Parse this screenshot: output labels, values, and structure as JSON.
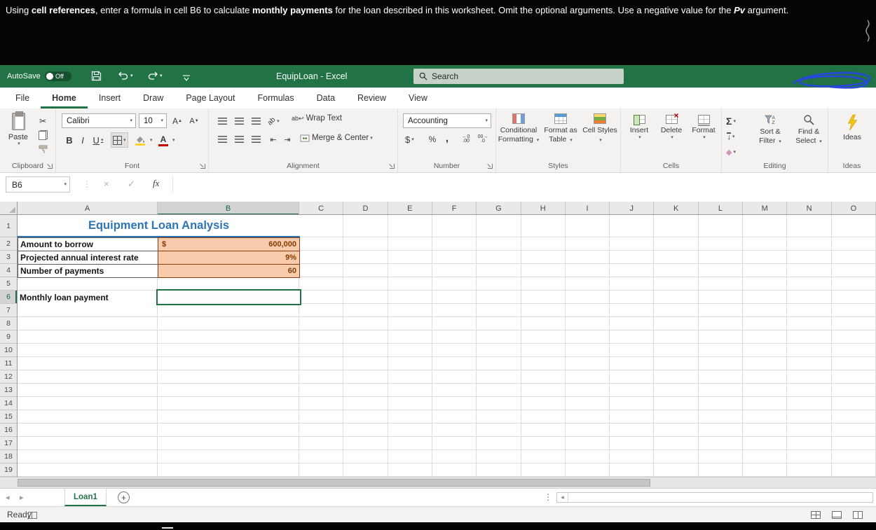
{
  "instruction": {
    "seg1": "Using ",
    "bold1": "cell references",
    "seg2": ", enter a formula in cell B6 to calculate ",
    "bold2": "monthly payments",
    "seg3": " for the loan described in this worksheet. Omit the optional arguments. Use a negative value for the ",
    "italic1": "Pv",
    "seg4": " argument."
  },
  "title_bar": {
    "autosave_label": "AutoSave",
    "autosave_state": "Off",
    "workbook_title": "EquipLoan - Excel",
    "search_placeholder": "Search"
  },
  "ribbon_tabs": {
    "file": "File",
    "home": "Home",
    "insert": "Insert",
    "draw": "Draw",
    "page_layout": "Page Layout",
    "formulas": "Formulas",
    "data": "Data",
    "review": "Review",
    "view": "View"
  },
  "ribbon": {
    "clipboard": {
      "paste": "Paste",
      "group_label": "Clipboard"
    },
    "font": {
      "font_name": "Calibri",
      "font_size": "10",
      "group_label": "Font"
    },
    "alignment": {
      "wrap_text": "Wrap Text",
      "merge_center": "Merge & Center",
      "group_label": "Alignment"
    },
    "number": {
      "format": "Accounting",
      "group_label": "Number"
    },
    "styles": {
      "conditional": "Conditional Formatting",
      "format_table": "Format as Table",
      "cell_styles": "Cell Styles",
      "group_label": "Styles"
    },
    "cells": {
      "insert": "Insert",
      "delete": "Delete",
      "format": "Format",
      "group_label": "Cells"
    },
    "editing": {
      "sort_filter": "Sort & Filter",
      "find_select": "Find & Select",
      "group_label": "Editing"
    },
    "ideas": {
      "button": "Ideas",
      "group_label": "Ideas"
    }
  },
  "formula_bar": {
    "name_box": "B6",
    "fx": "fx",
    "formula_value": ""
  },
  "sheet": {
    "columns": [
      "A",
      "B",
      "C",
      "D",
      "E",
      "F",
      "G",
      "H",
      "I",
      "J",
      "K",
      "L",
      "M",
      "N",
      "O"
    ],
    "row_numbers": [
      "1",
      "2",
      "3",
      "4",
      "5",
      "6",
      "7",
      "8",
      "9",
      "10",
      "11",
      "12",
      "13",
      "14",
      "15",
      "16",
      "17",
      "18",
      "19"
    ],
    "selected_column": "B",
    "selected_row": "6",
    "title_cell": "Equipment Loan Analysis",
    "rows": [
      {
        "label": "Amount to borrow",
        "currency": "$",
        "value": "600,000"
      },
      {
        "label": "Projected annual interest rate",
        "currency": "",
        "value": "9%"
      },
      {
        "label": "Number of payments",
        "currency": "",
        "value": "60"
      }
    ],
    "result_label": "Monthly loan payment",
    "result_value": ""
  },
  "tab_bar": {
    "sheet_name": "Loan1"
  },
  "status_bar": {
    "status": "Ready"
  },
  "colors": {
    "titlebar_green": "#217346",
    "selection_green": "#217346",
    "worksheet_title_blue": "#2E75B6",
    "input_cell_fill": "#F8CBAD",
    "input_cell_text": "#833C00"
  }
}
